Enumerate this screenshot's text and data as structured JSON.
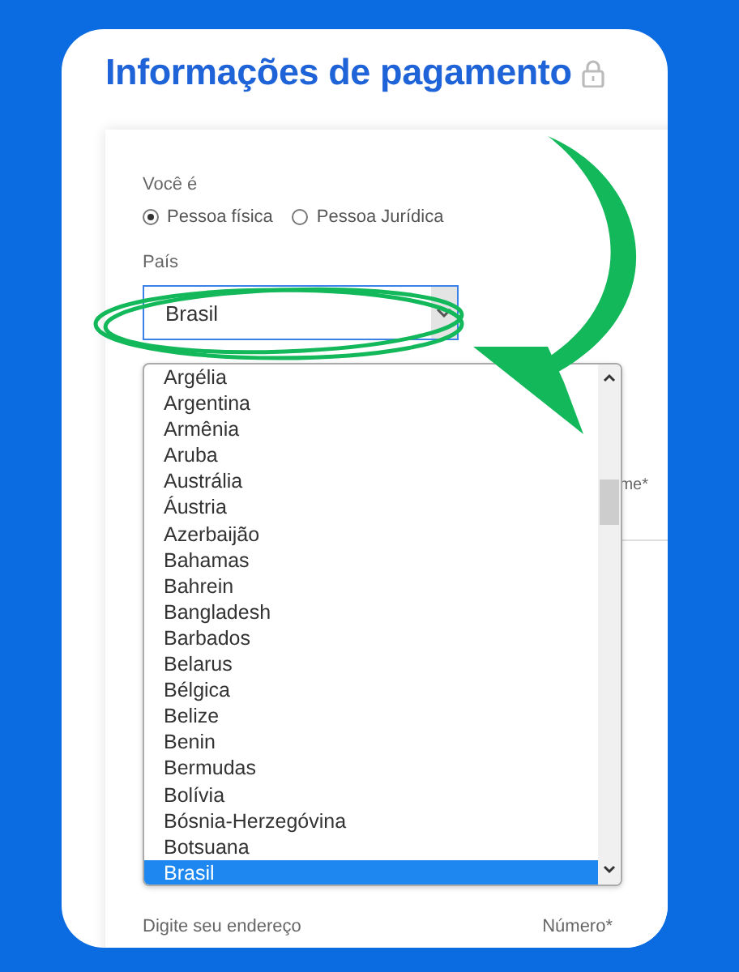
{
  "title": "Informações de pagamento",
  "form": {
    "person_type": {
      "label": "Você é",
      "options": [
        {
          "label": "Pessoa física",
          "selected": true
        },
        {
          "label": "Pessoa Jurídica",
          "selected": false
        }
      ]
    },
    "country": {
      "label": "País",
      "value": "Brasil",
      "options": [
        {
          "label": "Argélia",
          "selected": false
        },
        {
          "label": "Argentina",
          "selected": false
        },
        {
          "label": "Armênia",
          "selected": false
        },
        {
          "label": "Aruba",
          "selected": false
        },
        {
          "label": "Austrália",
          "selected": false
        },
        {
          "label": "Áustria",
          "selected": false
        },
        {
          "label": "Azerbaijão",
          "selected": false
        },
        {
          "label": "Bahamas",
          "selected": false
        },
        {
          "label": "Bahrein",
          "selected": false
        },
        {
          "label": "Bangladesh",
          "selected": false
        },
        {
          "label": "Barbados",
          "selected": false
        },
        {
          "label": "Belarus",
          "selected": false
        },
        {
          "label": "Bélgica",
          "selected": false
        },
        {
          "label": "Belize",
          "selected": false
        },
        {
          "label": "Benin",
          "selected": false
        },
        {
          "label": "Bermudas",
          "selected": false
        },
        {
          "label": "Bolívia",
          "selected": false
        },
        {
          "label": "Bósnia-Herzegóvina",
          "selected": false
        },
        {
          "label": "Botsuana",
          "selected": false
        },
        {
          "label": "Brasil",
          "selected": true
        }
      ]
    },
    "partial_label": "me*",
    "address_label": "Digite seu endereço",
    "number_label": "Número*"
  }
}
